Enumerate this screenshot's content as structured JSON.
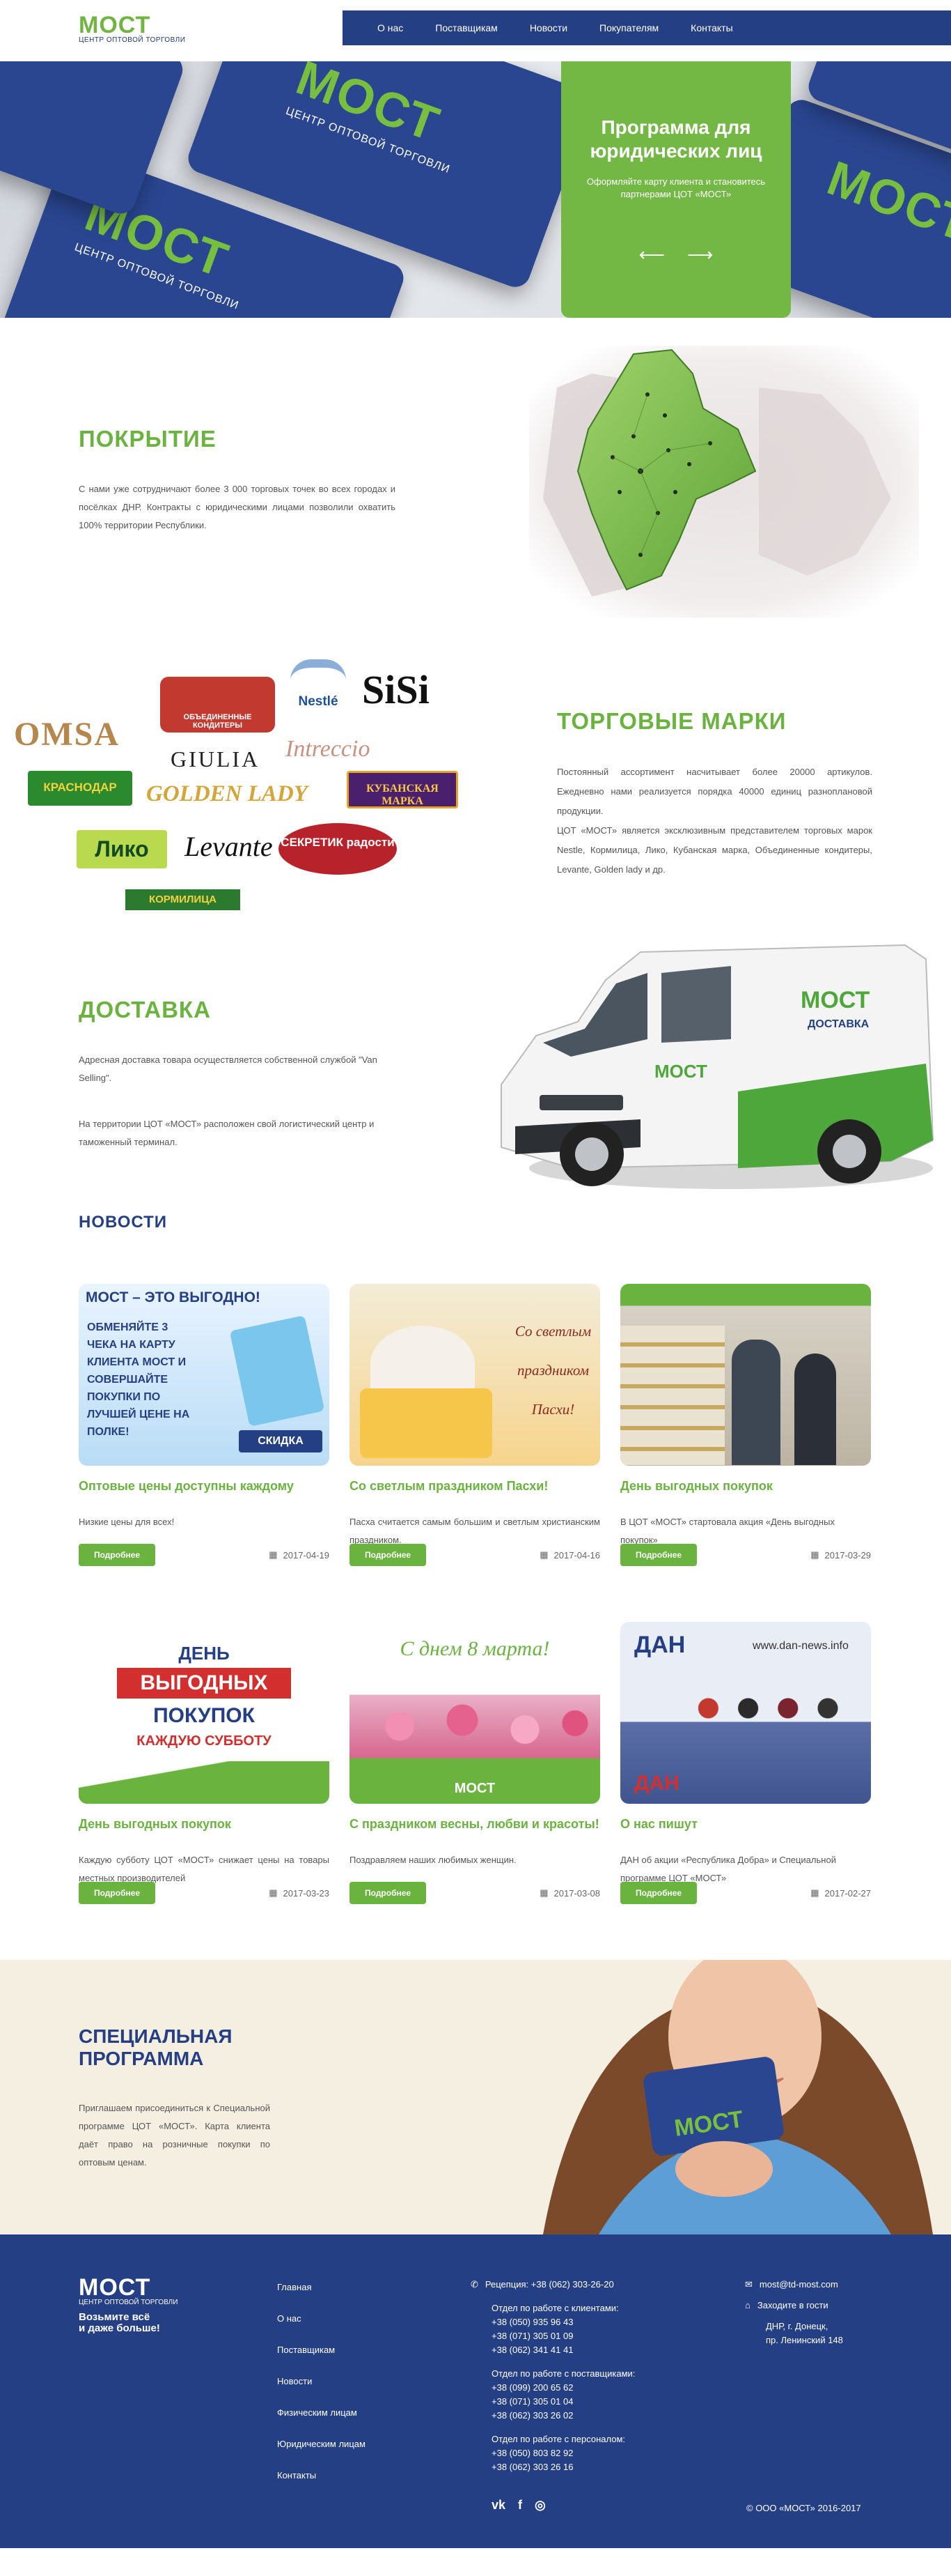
{
  "header": {
    "logo": "МОСТ",
    "logo_sub": "ЦЕНТР ОПТОВОЙ ТОРГОВЛИ",
    "nav": [
      "О нас",
      "Поставщикам",
      "Новости",
      "Покупателям",
      "Контакты"
    ]
  },
  "hero": {
    "card_logo": "МОСТ",
    "card_sub": "ЦЕНТР ОПТОВОЙ ТОРГОВЛИ",
    "title": "Программа для юридических лиц",
    "text": "Оформляйте карту клиента и становитесь партнерами ЦОТ «МОСТ»",
    "arrow_prev": "⟵",
    "arrow_next": "⟶"
  },
  "coverage": {
    "title": "ПОКРЫТИЕ",
    "text": "С нами уже сотрудничают более 3 000 торговых точек во всех городах и посёлках ДНР. Контракты с юридическими лицами позволили охватить 100% территории Республики."
  },
  "brands": {
    "title": "ТОРГОВЫЕ МАРКИ",
    "text1": "Постоянный ассортимент насчитывает более 20000 артикулов. Ежедневно нами реализуется порядка 40000 единиц разноплановой продукции.",
    "text2": "ЦОТ «МОСТ» является эксклюзивным представителем торговых марок Nestle, Кормилица, Лико, Кубанская марка, Объединенные кондитеры, Levante, Golden lady и др.",
    "logos": {
      "omsa": "OMSA",
      "nestle": "Nestlé",
      "sisi": "SiSi",
      "giulia": "GIULIA",
      "intreccio": "Intreccio",
      "krasnodar": "КРАСНОДАР",
      "golden": "GOLDEN LADY",
      "kuban": "КУБАНСКАЯ МАРКА",
      "liko": "Лико",
      "levante": "Levante",
      "sekretik": "СЕКРЕТИК радости",
      "kormilitsa": "КОРМИЛИЦА",
      "konditery": "ОБЪЕДИНЕННЫЕ КОНДИТЕРЫ"
    }
  },
  "delivery": {
    "title": "ДОСТАВКА",
    "text1": "Адресная доставка товара осуществляется собственной службой \"Van Selling\".",
    "text2": "На территории ЦОТ «МОСТ» расположен свой логистический центр и таможенный терминал.",
    "van_logo": "МОСТ",
    "van_sub": "ДОСТАВКА"
  },
  "news": {
    "title": "НОВОСТИ",
    "more_label": "Подробнее",
    "items": [
      {
        "title": "Оптовые цены доступны каждому",
        "text": "Низкие цены для всех!",
        "date": "2017-04-19"
      },
      {
        "title": "Со светлым праздником Пасхи!",
        "text": "Пасха считается самым большим и светлым христианским праздником.",
        "date": "2017-04-16"
      },
      {
        "title": "День выгодных покупок",
        "text": "В ЦОТ «МОСТ» стартовала акция «День выгодных покупок»",
        "date": "2017-03-29"
      },
      {
        "title": "День выгодных покупок",
        "text": "Каждую субботу ЦОТ «МОСТ» снижает цены на товары местных производителей",
        "date": "2017-03-23"
      },
      {
        "title": "С праздником весны, любви и красоты!",
        "text": "Поздравляем наших любимых женщин.",
        "date": "2017-03-08"
      },
      {
        "title": "О нас пишут",
        "text": "ДАН об акции «Республика Добра» и Специальной программе ЦОТ «МОСТ»",
        "date": "2017-02-27"
      }
    ],
    "img1": {
      "head": "МОСТ – ЭТО ВЫГОДНО!",
      "body": "ОБМЕНЯЙТЕ 3 ЧЕКА НА КАРТУ КЛИЕНТА МОСТ И СОВЕРШАЙТЕ ПОКУПКИ ПО ЛУЧШЕЙ ЦЕНЕ НА ПОЛКЕ!",
      "badge": "СКИДКА"
    },
    "img2": {
      "l1": "Со светлым",
      "l2": "праздником",
      "l3": "Пасхи!"
    },
    "img4": {
      "l1": "ДЕНЬ",
      "l2": "ВЫГОДНЫХ",
      "l3": "ПОКУПОК",
      "l4": "КАЖДУЮ СУББОТУ"
    },
    "img5": {
      "head": "С днем 8 марта!",
      "logo": "МОСТ"
    },
    "img6": {
      "site": "www.dan-news.info",
      "logo": "ДАН"
    }
  },
  "special": {
    "title": "СПЕЦИАЛЬНАЯ ПРОГРАММА",
    "text": "Приглашаем присоединиться к Специальной программе ЦОТ «МОСТ». Карта клиента даёт право на розничные покупки по оптовым ценам.",
    "card_logo": "МОСТ"
  },
  "footer": {
    "logo": "МОСТ",
    "logo_sub": "ЦЕНТР ОПТОВОЙ ТОРГОВЛИ",
    "slogan1": "Возьмите всё",
    "slogan2": "и даже больше!",
    "menu": [
      "Главная",
      "О нас",
      "Поставщикам",
      "Новости",
      "Физическим лицам",
      "Юридическим лицам",
      "Контакты"
    ],
    "reception": "Рецепция: +38 (062) 303-26-20",
    "clients_h": "Отдел по работе с клиентами:",
    "clients": [
      "+38 (050) 935 96 43",
      "+38 (071) 305 01 09",
      "+38 (062) 341 41 41"
    ],
    "suppliers_h": "Отдел по работе с поставщиками:",
    "suppliers": [
      "+38 (099) 200 65 62",
      "+38 (071) 305 01 04",
      "+38 (062) 303 26 02"
    ],
    "staff_h": "Отдел по работе с персоналом:",
    "staff": [
      "+38 (050) 803 82 92",
      "+38 (062) 303 26 16"
    ],
    "email": "most@td-most.com",
    "visit": "Заходите в гости",
    "addr1": "ДНР, г. Донецк,",
    "addr2": "пр. Ленинский 148",
    "social": [
      "vk",
      "f",
      "◎"
    ],
    "copyright": "© ООО «МОСТ» 2016-2017"
  }
}
